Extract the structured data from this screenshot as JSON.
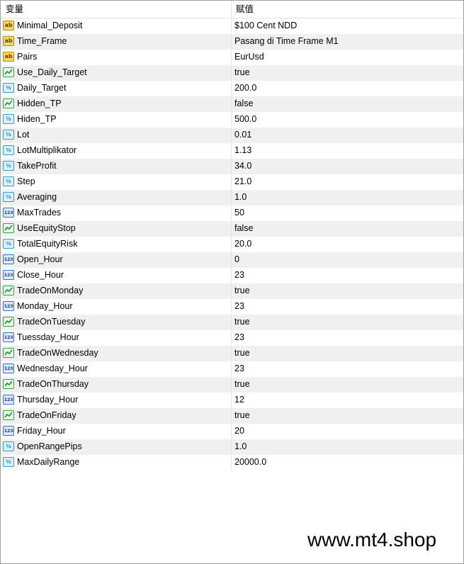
{
  "header": {
    "col_variable": "变量",
    "col_value": "赋值"
  },
  "rows": [
    {
      "type": "ab",
      "name": "Minimal_Deposit",
      "value": "$100 Cent NDD"
    },
    {
      "type": "ab",
      "name": "Time_Frame",
      "value": "Pasang di Time Frame M1"
    },
    {
      "type": "ab",
      "name": "Pairs",
      "value": "EurUsd"
    },
    {
      "type": "bool",
      "name": "Use_Daily_Target",
      "value": "true"
    },
    {
      "type": "dbl",
      "name": "Daily_Target",
      "value": "200.0"
    },
    {
      "type": "bool",
      "name": "Hidden_TP",
      "value": "false"
    },
    {
      "type": "dbl",
      "name": "Hiden_TP",
      "value": "500.0"
    },
    {
      "type": "dbl",
      "name": "Lot",
      "value": "0.01"
    },
    {
      "type": "dbl",
      "name": "LotMultiplikator",
      "value": "1.13"
    },
    {
      "type": "dbl",
      "name": "TakeProfit",
      "value": "34.0"
    },
    {
      "type": "dbl",
      "name": "Step",
      "value": "21.0"
    },
    {
      "type": "dbl",
      "name": "Averaging",
      "value": "1.0"
    },
    {
      "type": "int",
      "name": "MaxTrades",
      "value": "50"
    },
    {
      "type": "bool",
      "name": "UseEquityStop",
      "value": "false"
    },
    {
      "type": "dbl",
      "name": "TotalEquityRisk",
      "value": "20.0"
    },
    {
      "type": "int",
      "name": "Open_Hour",
      "value": "0"
    },
    {
      "type": "int",
      "name": "Close_Hour",
      "value": "23"
    },
    {
      "type": "bool",
      "name": "TradeOnMonday",
      "value": "true"
    },
    {
      "type": "int",
      "name": "Monday_Hour",
      "value": "23"
    },
    {
      "type": "bool",
      "name": "TradeOnTuesday",
      "value": "true"
    },
    {
      "type": "int",
      "name": "Tuessday_Hour",
      "value": "23"
    },
    {
      "type": "bool",
      "name": "TradeOnWednesday",
      "value": "true"
    },
    {
      "type": "int",
      "name": "Wednesday_Hour",
      "value": "23"
    },
    {
      "type": "bool",
      "name": "TradeOnThursday",
      "value": "true"
    },
    {
      "type": "int",
      "name": "Thursday_Hour",
      "value": "12"
    },
    {
      "type": "bool",
      "name": "TradeOnFriday",
      "value": "true"
    },
    {
      "type": "int",
      "name": "Friday_Hour",
      "value": "20"
    },
    {
      "type": "dbl",
      "name": "OpenRangePips",
      "value": "1.0"
    },
    {
      "type": "dbl",
      "name": "MaxDailyRange",
      "value": "20000.0"
    }
  ],
  "icon_labels": {
    "ab": "ab",
    "dbl": "½",
    "int": "123"
  },
  "watermark": "www.mt4.shop"
}
